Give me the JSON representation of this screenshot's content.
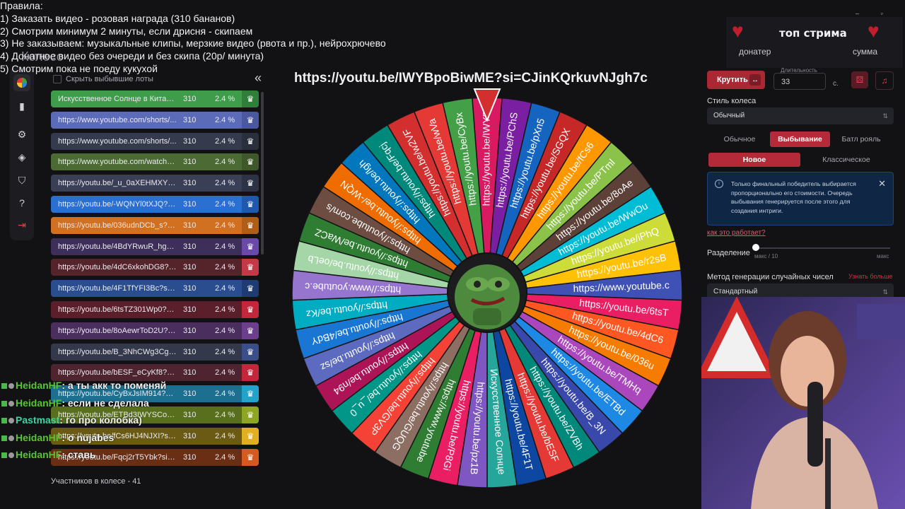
{
  "rules_overlay": [
    "Правила:",
    "1) Заказать видео - розовая награда (310 бананов)",
    "2) Смотрим минимум 2 минуты, если дрисня - скипаем",
    "3) Не заказываем: музыкальные клипы, мерзкие видео (рвота и пр.), нейрохрючево",
    "4) Донатное видео без очереди и без скипа (20р/ минута)",
    "5) Смотрим пока не поеду кукухой"
  ],
  "header": {
    "tab_title": "Колесо",
    "collapse_icon": "«"
  },
  "sidebar": {
    "icons": [
      "wheel-icon",
      "chart-icon",
      "gear-icon",
      "layers-icon",
      "shield-icon",
      "help-icon",
      "logout-icon"
    ]
  },
  "lots_panel": {
    "hide_checkbox_label": "Скрыть выбывшие лоты",
    "participants_label": "Участников в колесе - 41",
    "lots": [
      {
        "name": "Искусственное Солнце в Китае ...",
        "amount": "310",
        "percent": "2.4 %",
        "color": "#3f9c4a",
        "accent": "#2f7e39"
      },
      {
        "name": "https://www.youtube.com/shorts/...",
        "amount": "310",
        "percent": "2.4 %",
        "color": "#5b6bb8",
        "accent": "#4a58a0"
      },
      {
        "name": "https://www.youtube.com/shorts/...",
        "amount": "310",
        "percent": "2.4 %",
        "color": "#353b4c",
        "accent": "#2a2f3e"
      },
      {
        "name": "https://www.youtube.com/watch?...",
        "amount": "310",
        "percent": "2.4 %",
        "color": "#4c6a34",
        "accent": "#3e582a"
      },
      {
        "name": "https://youtu.be/_u_0aXEHMXY?si...",
        "amount": "310",
        "percent": "2.4 %",
        "color": "#3a3f55",
        "accent": "#2e3246"
      },
      {
        "name": "https://youtu.be/-WQNYl0tXJQ?si...",
        "amount": "310",
        "percent": "2.4 %",
        "color": "#2b6fd0",
        "accent": "#1f58ad"
      },
      {
        "name": "https://youtu.be/036udnDCb_s?si...",
        "amount": "310",
        "percent": "2.4 %",
        "color": "#d07020",
        "accent": "#b05d15"
      },
      {
        "name": "https://youtu.be/4BdYRwuR_hg?s...",
        "amount": "310",
        "percent": "2.4 %",
        "color": "#3d2f59",
        "accent": "#6a4aa8"
      },
      {
        "name": "https://youtu.be/4dC6xkohDG8?s...",
        "amount": "310",
        "percent": "2.4 %",
        "color": "#55232a",
        "accent": "#c23a48"
      },
      {
        "name": "https://youtu.be/4F1TfYFI3Bc?si=...",
        "amount": "310",
        "percent": "2.4 %",
        "color": "#2a4d8f",
        "accent": "#1e3b72"
      },
      {
        "name": "https://youtu.be/6tsTZ301Wp0?si...",
        "amount": "310",
        "percent": "2.4 %",
        "color": "#5a1f2a",
        "accent": "#c2273c"
      },
      {
        "name": "https://youtu.be/8oAewrToD2U?si...",
        "amount": "310",
        "percent": "2.4 %",
        "color": "#4a2f5e",
        "accent": "#6c3f8c"
      },
      {
        "name": "https://youtu.be/B_3NhCWg3Cg?...",
        "amount": "310",
        "percent": "2.4 %",
        "color": "#33384a",
        "accent": "#3a4f8a"
      },
      {
        "name": "https://youtu.be/bESF_eCyKf8?si...",
        "amount": "310",
        "percent": "2.4 %",
        "color": "#4d2430",
        "accent": "#c2273c"
      },
      {
        "name": "https://youtu.be/CyBxJsIM914?si...",
        "amount": "310",
        "percent": "2.4 %",
        "color": "#1d6f8f",
        "accent": "#23a3c9"
      },
      {
        "name": "https://youtu.be/ETBd3IWYSCo?s...",
        "amount": "310",
        "percent": "2.4 %",
        "color": "#5a6f1d",
        "accent": "#8fa623"
      },
      {
        "name": "https://youtu.be/fCs6HJ4NJXI?si=...",
        "amount": "310",
        "percent": "2.4 %",
        "color": "#6b5a14",
        "accent": "#e0b020"
      },
      {
        "name": "https://youtu.be/Fqcj2rT5Ybk?si=...",
        "amount": "310",
        "percent": "2.4 %",
        "color": "#6a2e14",
        "accent": "#d45a20"
      }
    ]
  },
  "wheel": {
    "current_title": "https://youtu.be/IWYBpoBiwME?si=CJinKQrkuvNJgh7c",
    "segments": [
      "https://youtu.be/IWYB",
      "https://youtu.be/PChS",
      "https://youtu.be/pXn5",
      "https://youtu.be/SGQX",
      "https://youtu.be/fCs6",
      "https://youtu.be/PTml",
      "https://youtu.be/8oAe",
      "https://youtu.be/WwOu",
      "https://youtu.be/iPhQ",
      "https://youtu.be/r2sB",
      "https://www.youtube.c",
      "https://youtu.be/6tsT",
      "https://youtu.be/4dC6",
      "https://youtu.be/036u",
      "https://youtu.be/TMHq",
      "https://youtu.be/ETBd",
      "https://youtu.be/B_3N",
      "https://youtu.be/ZVBh",
      "https://youtu.be/bESF",
      "https://youtu.be/4F1T",
      "Искусственное Солнце",
      "https://youtu.be/pz1B",
      "https://youtu.be/P8Gi",
      "https://www.youtube",
      "https://youtu.be/GUQG",
      "https://youtu.be/GV3P",
      "https://youtu.be/_u_0",
      "https://youtu.be/n94",
      "https://youtu.be/sz",
      "https://youtu.be/4BdY",
      "https://youtu.be/Kz",
      "https://www.youtube.c",
      "https://youtu.be/oeLb",
      "https://youtu.be/WaCZ",
      "https://youtube.com/s",
      "https://youtu.be/-WQN",
      "https://youtu.be/lgh",
      "https://youtu.be/Fqcj",
      "https://youtu.be/w2VF",
      "https://youtu.be/wVa",
      "https://youtu.be/CyBx"
    ],
    "colors": [
      "#d81b60",
      "#7b1fa2",
      "#1565c0",
      "#c62828",
      "#ff9800",
      "#8bc34a",
      "#5d4037",
      "#00bcd4",
      "#cddc39",
      "#ffc107",
      "#3f51b5",
      "#e91e63",
      "#ff5722",
      "#f57c00",
      "#ab47bc",
      "#1e88e5",
      "#3949ab",
      "#00897b",
      "#e53935",
      "#0d47a1",
      "#26a69a",
      "#7e57c2",
      "#e91e63",
      "#2e7d32",
      "#8d6e63",
      "#f44336",
      "#009688",
      "#ad1457",
      "#5c6bc0",
      "#1976d2",
      "#00acc1",
      "#9575cd",
      "#a5d6a7",
      "#2e7d32",
      "#6d4c41",
      "#ef6c00",
      "#0277bd",
      "#00897b",
      "#d32f2f",
      "#e53935",
      "#43a047"
    ]
  },
  "settings": {
    "spin_button": "Крутить",
    "spin_mini": "↔",
    "duration_label": "Длительность",
    "duration_value": "33",
    "duration_unit": "с.",
    "dice_icon": "dice-icon",
    "music_icon": "music-icon",
    "wheel_style_label": "Стиль колеса",
    "wheel_style_value": "Обычный",
    "modes": [
      "Обычное",
      "Выбывание",
      "Батл рояль"
    ],
    "active_mode": "Выбывание",
    "submodes": [
      "Новое",
      "Классическое"
    ],
    "active_submode": "Новое",
    "info_text": "Только финальный победитель выбирается пропорционально его стоимости. Очередь выбывания генерируется после этого для создания интриги.",
    "how_link": "как это работает?",
    "split_label": "Разделение",
    "split_min": "макс / 10",
    "split_max": "макс",
    "rng_label": "Метод генерации случайных чисел",
    "rng_more": "Узнать больше",
    "rng_value": "Стандартный"
  },
  "top_widget": {
    "title": "топ стрима",
    "left": "донатер",
    "right": "сумма"
  },
  "chat": [
    {
      "user": "HeidanHF",
      "text": ": а ты акк то поменяй",
      "alt": false
    },
    {
      "user": "HeidanHF",
      "text": ": если не сделала",
      "alt": false
    },
    {
      "user": "Pastmast",
      "text": ": го про колобка)",
      "alt": true
    },
    {
      "user": "HeidanHF",
      "text": ": o nujabes",
      "alt": false
    },
    {
      "user": "HeidanHF",
      "text": ": ставь",
      "alt": false
    }
  ]
}
